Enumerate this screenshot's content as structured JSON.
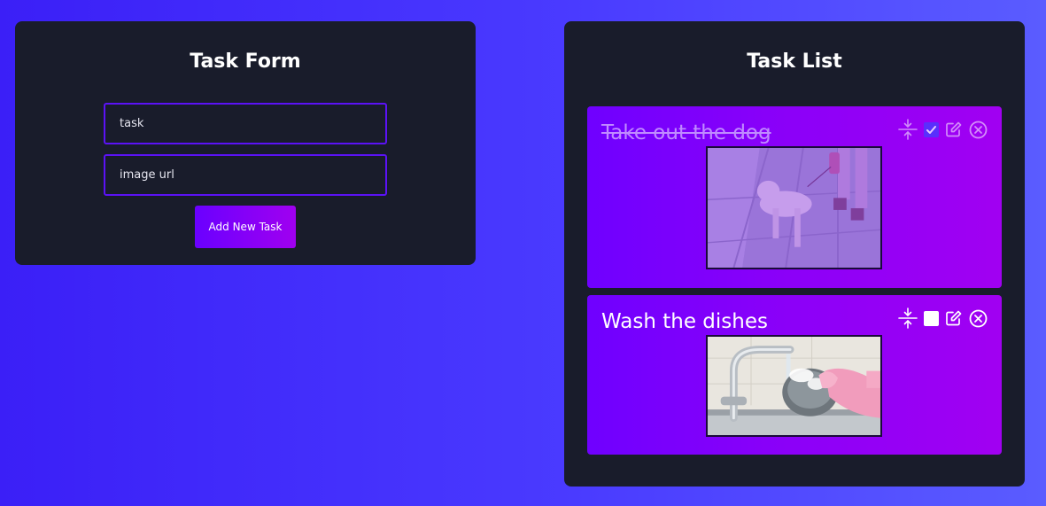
{
  "form": {
    "title": "Task Form",
    "task_placeholder": "task",
    "url_placeholder": "image url",
    "add_button_label": "Add New Task"
  },
  "list": {
    "title": "Task List",
    "tasks": [
      {
        "title": "Take out the dog",
        "completed": true,
        "image": "dog-walk-photo"
      },
      {
        "title": "Wash the dishes",
        "completed": false,
        "image": "dish-washing-photo"
      }
    ]
  },
  "icons": {
    "collapse": "collapse-icon",
    "edit": "edit-icon",
    "delete": "close-circle-icon",
    "check": "check-icon"
  },
  "colors": {
    "background_start": "#3b1ff7",
    "background_end": "#5a5cff",
    "panel": "#191c2b",
    "input_border": "#5b12f5",
    "card_start": "#6f00ff",
    "card_end": "#a100f2",
    "completed_text": "#c08bff"
  }
}
